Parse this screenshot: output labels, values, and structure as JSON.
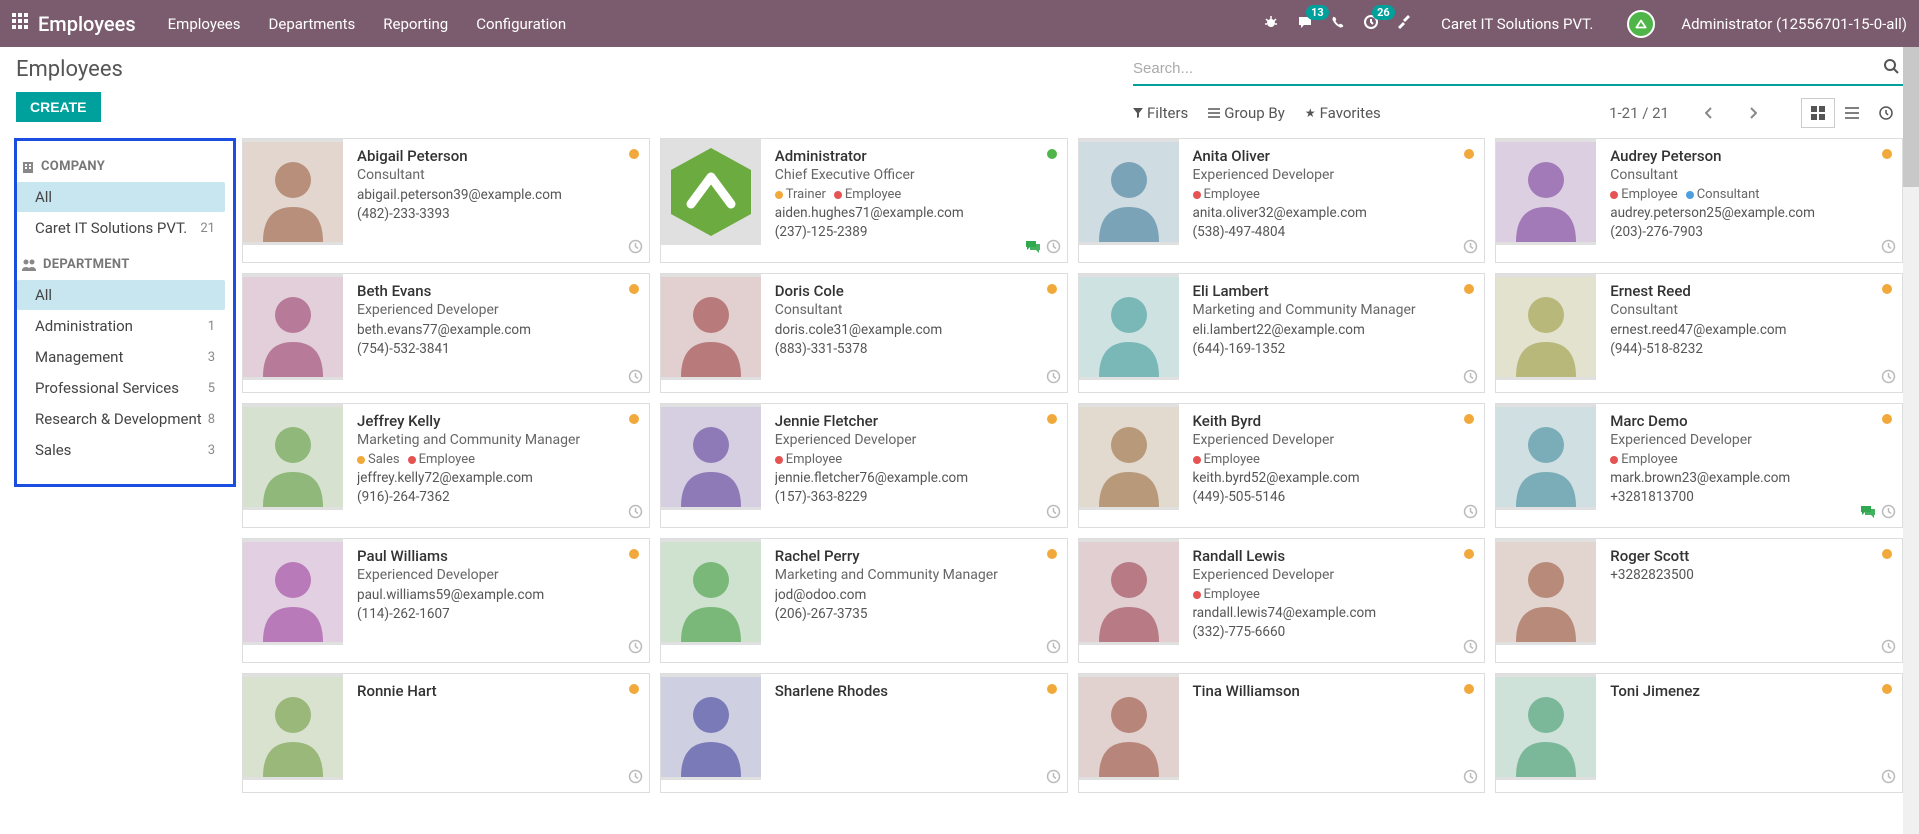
{
  "topbar": {
    "brand": "Employees",
    "nav": [
      "Employees",
      "Departments",
      "Reporting",
      "Configuration"
    ],
    "msg_badge": "13",
    "activity_badge": "26",
    "company": "Caret IT Solutions PVT.",
    "user": "Administrator (12556701-15-0-all)"
  },
  "header": {
    "title": "Employees",
    "create_label": "CREATE",
    "search_placeholder": "Search..."
  },
  "filterbar": {
    "filters": "Filters",
    "groupby": "Group By",
    "favorites": "Favorites",
    "pager": "1-21 / 21"
  },
  "sidebar": {
    "company_label": "COMPANY",
    "department_label": "DEPARTMENT",
    "company_items": [
      {
        "label": "All",
        "count": "",
        "active": true
      },
      {
        "label": "Caret IT Solutions PVT.",
        "count": "21",
        "active": false
      }
    ],
    "department_items": [
      {
        "label": "All",
        "count": "",
        "active": true
      },
      {
        "label": "Administration",
        "count": "1",
        "active": false
      },
      {
        "label": "Management",
        "count": "3",
        "active": false
      },
      {
        "label": "Professional Services",
        "count": "5",
        "active": false
      },
      {
        "label": "Research & Development",
        "count": "8",
        "active": false
      },
      {
        "label": "Sales",
        "count": "3",
        "active": false
      }
    ]
  },
  "colors": {
    "status_yellow": "#f2a93b",
    "status_green": "#4fb548",
    "tag_orange": "#f2a93b",
    "tag_red": "#e55353",
    "tag_blue": "#4f9fe0"
  },
  "employees": [
    {
      "name": "Abigail Peterson",
      "title": "Consultant",
      "tags": [],
      "email": "abigail.peterson39@example.com",
      "phone": "(482)-233-3393",
      "status": "yellow",
      "chat": false
    },
    {
      "name": "Administrator",
      "title": "Chief Executive Officer",
      "tags": [
        {
          "label": "Trainer",
          "color": "orange"
        },
        {
          "label": "Employee",
          "color": "red"
        }
      ],
      "email": "aiden.hughes71@example.com",
      "phone": "(237)-125-2389",
      "status": "green",
      "chat": true,
      "logo": true
    },
    {
      "name": "Anita Oliver",
      "title": "Experienced Developer",
      "tags": [
        {
          "label": "Employee",
          "color": "red"
        }
      ],
      "email": "anita.oliver32@example.com",
      "phone": "(538)-497-4804",
      "status": "yellow",
      "chat": false
    },
    {
      "name": "Audrey Peterson",
      "title": "Consultant",
      "tags": [
        {
          "label": "Employee",
          "color": "red"
        },
        {
          "label": "Consultant",
          "color": "blue"
        }
      ],
      "email": "audrey.peterson25@example.com",
      "phone": "(203)-276-7903",
      "status": "yellow",
      "chat": false
    },
    {
      "name": "Beth Evans",
      "title": "Experienced Developer",
      "tags": [],
      "email": "beth.evans77@example.com",
      "phone": "(754)-532-3841",
      "status": "yellow",
      "chat": false
    },
    {
      "name": "Doris Cole",
      "title": "Consultant",
      "tags": [],
      "email": "doris.cole31@example.com",
      "phone": "(883)-331-5378",
      "status": "yellow",
      "chat": false
    },
    {
      "name": "Eli Lambert",
      "title": "Marketing and Community Manager",
      "tags": [],
      "email": "eli.lambert22@example.com",
      "phone": "(644)-169-1352",
      "status": "yellow",
      "chat": false
    },
    {
      "name": "Ernest Reed",
      "title": "Consultant",
      "tags": [],
      "email": "ernest.reed47@example.com",
      "phone": "(944)-518-8232",
      "status": "yellow",
      "chat": false
    },
    {
      "name": "Jeffrey Kelly",
      "title": "Marketing and Community Manager",
      "tags": [
        {
          "label": "Sales",
          "color": "orange"
        },
        {
          "label": "Employee",
          "color": "red"
        }
      ],
      "email": "jeffrey.kelly72@example.com",
      "phone": "(916)-264-7362",
      "status": "yellow",
      "chat": false
    },
    {
      "name": "Jennie Fletcher",
      "title": "Experienced Developer",
      "tags": [
        {
          "label": "Employee",
          "color": "red"
        }
      ],
      "email": "jennie.fletcher76@example.com",
      "phone": "(157)-363-8229",
      "status": "yellow",
      "chat": false
    },
    {
      "name": "Keith Byrd",
      "title": "Experienced Developer",
      "tags": [
        {
          "label": "Employee",
          "color": "red"
        }
      ],
      "email": "keith.byrd52@example.com",
      "phone": "(449)-505-5146",
      "status": "yellow",
      "chat": false
    },
    {
      "name": "Marc Demo",
      "title": "Experienced Developer",
      "tags": [
        {
          "label": "Employee",
          "color": "red"
        }
      ],
      "email": "mark.brown23@example.com",
      "phone": "+3281813700",
      "status": "yellow",
      "chat": true
    },
    {
      "name": "Paul Williams",
      "title": "Experienced Developer",
      "tags": [],
      "email": "paul.williams59@example.com",
      "phone": "(114)-262-1607",
      "status": "yellow",
      "chat": false
    },
    {
      "name": "Rachel Perry",
      "title": "Marketing and Community Manager",
      "tags": [],
      "email": "jod@odoo.com",
      "phone": "(206)-267-3735",
      "status": "yellow",
      "chat": false
    },
    {
      "name": "Randall Lewis",
      "title": "Experienced Developer",
      "tags": [
        {
          "label": "Employee",
          "color": "red"
        }
      ],
      "email": "randall.lewis74@example.com",
      "phone": "(332)-775-6660",
      "status": "yellow",
      "chat": false
    },
    {
      "name": "Roger Scott",
      "title": "",
      "tags": [],
      "email": "",
      "phone": "+3282823500",
      "status": "yellow",
      "chat": false
    },
    {
      "name": "Ronnie Hart",
      "title": "",
      "tags": [],
      "email": "",
      "phone": "",
      "status": "yellow",
      "chat": false
    },
    {
      "name": "Sharlene Rhodes",
      "title": "",
      "tags": [],
      "email": "",
      "phone": "",
      "status": "yellow",
      "chat": false
    },
    {
      "name": "Tina Williamson",
      "title": "",
      "tags": [],
      "email": "",
      "phone": "",
      "status": "yellow",
      "chat": false
    },
    {
      "name": "Toni Jimenez",
      "title": "",
      "tags": [],
      "email": "",
      "phone": "",
      "status": "yellow",
      "chat": false
    }
  ]
}
